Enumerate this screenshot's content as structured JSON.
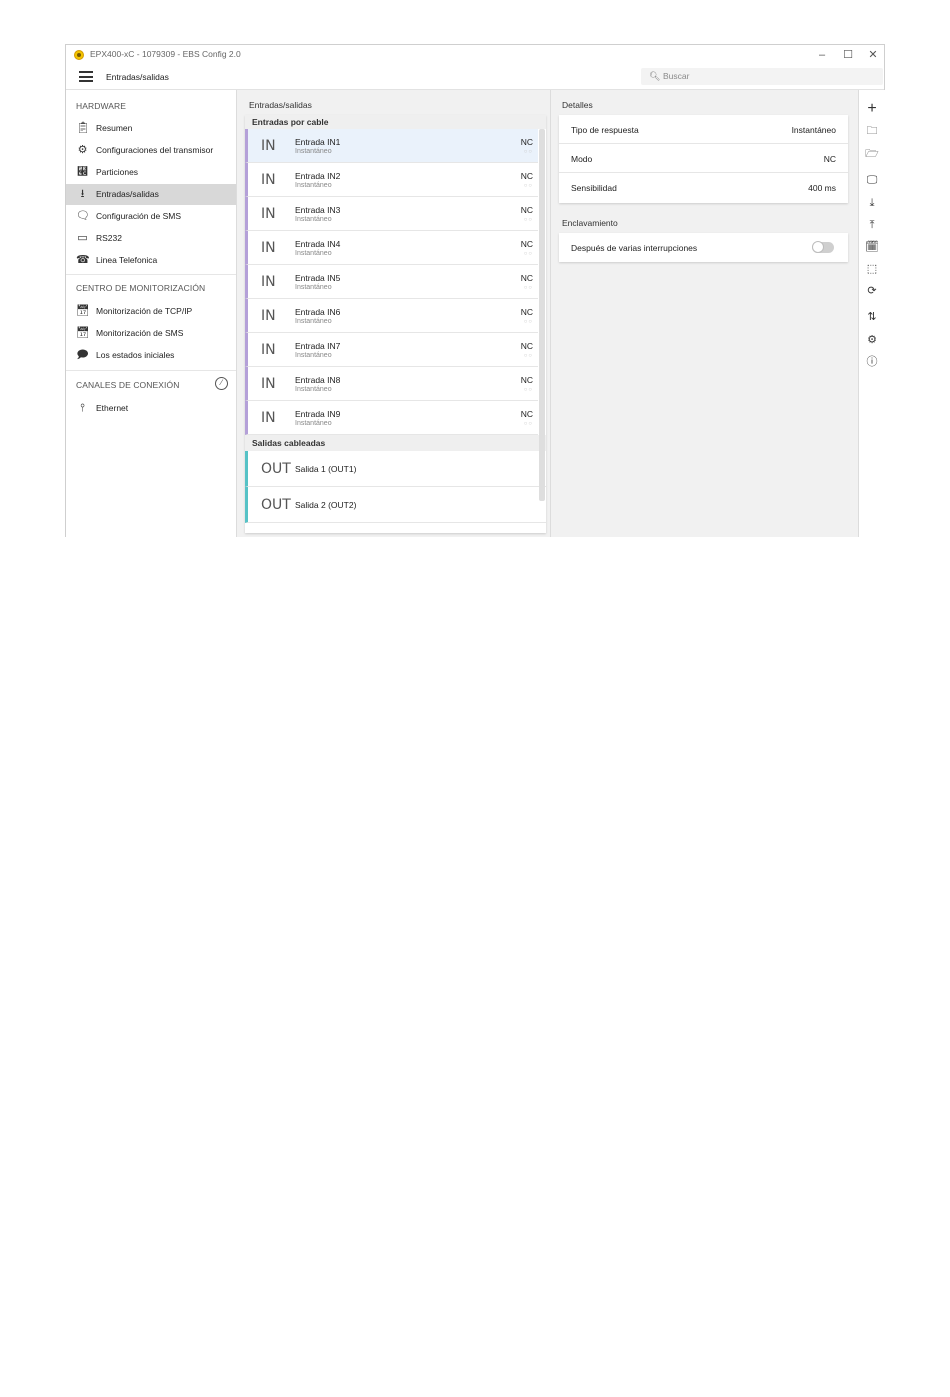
{
  "window": {
    "title": "EPX400-xC - 1079309 - EBS Config 2.0",
    "controls": [
      "–",
      "☐",
      "✕"
    ]
  },
  "menubar": {
    "crumb": "Entradas/salidas",
    "search_placeholder": "Buscar"
  },
  "sidebar": {
    "hardware_title": "HARDWARE",
    "hardware_items": [
      {
        "label": "Resumen",
        "icon": "clipboard-icon"
      },
      {
        "label": "Configuraciones del transmisor",
        "icon": "gear-icon"
      },
      {
        "label": "Particiones",
        "icon": "partitions-icon"
      },
      {
        "label": "Entradas/salidas",
        "icon": "io-icon"
      },
      {
        "label": "Configuración de SMS",
        "icon": "sms-icon"
      },
      {
        "label": "RS232",
        "icon": "rs232-icon"
      },
      {
        "label": "Linea Telefonica",
        "icon": "phone-icon"
      }
    ],
    "monitor_title": "CENTRO DE MONITORIZACIÓN",
    "monitor_items": [
      {
        "label": "Monitorización de TCP/IP",
        "icon": "calendar-icon"
      },
      {
        "label": "Monitorización de SMS",
        "icon": "calendar-icon"
      },
      {
        "label": "Los estados iniciales",
        "icon": "flag-message-icon"
      }
    ],
    "channels_title": "CANALES DE CONEXIÓN",
    "channels_items": [
      {
        "label": "Ethernet",
        "icon": "ethernet-plug-icon"
      }
    ]
  },
  "io": {
    "title": "Entradas/salidas",
    "inputs_header": "Entradas por cable",
    "inputs": [
      {
        "type": "IN",
        "name": "Entrada IN1",
        "sub": "Instantáneo",
        "mode": "NC",
        "dots": "○○"
      },
      {
        "type": "IN",
        "name": "Entrada IN2",
        "sub": "Instantáneo",
        "mode": "NC",
        "dots": "○○"
      },
      {
        "type": "IN",
        "name": "Entrada IN3",
        "sub": "Instantáneo",
        "mode": "NC",
        "dots": "○○"
      },
      {
        "type": "IN",
        "name": "Entrada IN4",
        "sub": "Instantáneo",
        "mode": "NC",
        "dots": "○○"
      },
      {
        "type": "IN",
        "name": "Entrada IN5",
        "sub": "Instantáneo",
        "mode": "NC",
        "dots": "○○"
      },
      {
        "type": "IN",
        "name": "Entrada IN6",
        "sub": "Instantáneo",
        "mode": "NC",
        "dots": "○○"
      },
      {
        "type": "IN",
        "name": "Entrada IN7",
        "sub": "Instantáneo",
        "mode": "NC",
        "dots": "○○"
      },
      {
        "type": "IN",
        "name": "Entrada IN8",
        "sub": "Instantáneo",
        "mode": "NC",
        "dots": "○○"
      },
      {
        "type": "IN",
        "name": "Entrada IN9",
        "sub": "Instantáneo",
        "mode": "NC",
        "dots": "○○"
      }
    ],
    "outputs_header": "Salidas cableadas",
    "outputs": [
      {
        "type": "OUT",
        "name": "Salida 1 (OUT1)"
      },
      {
        "type": "OUT",
        "name": "Salida 2 (OUT2)"
      }
    ]
  },
  "details": {
    "title": "Detalles",
    "rows": [
      {
        "label": "Tipo de respuesta",
        "value": "Instantáneo"
      },
      {
        "label": "Modo",
        "value": "NC"
      },
      {
        "label": "Sensibilidad",
        "value": "400 ms"
      }
    ],
    "latch_title": "Enclavamiento",
    "latch_label": "Después de varias interrupciones",
    "latch_on": false
  },
  "toolbar_icons": [
    "plus-icon",
    "folder-download-icon",
    "folder-upload-icon",
    "monitor-icon",
    "download-icon",
    "upload-icon",
    "calendar-grid-icon",
    "chip-icon",
    "refresh-icon",
    "transfer-icon",
    "gear-icon",
    "help-icon"
  ],
  "colors": {
    "input_accent": "#b4a0d8",
    "output_accent": "#56c2c6",
    "selected_row": "#eaf2fb",
    "active_nav": "#d8d8d8"
  }
}
